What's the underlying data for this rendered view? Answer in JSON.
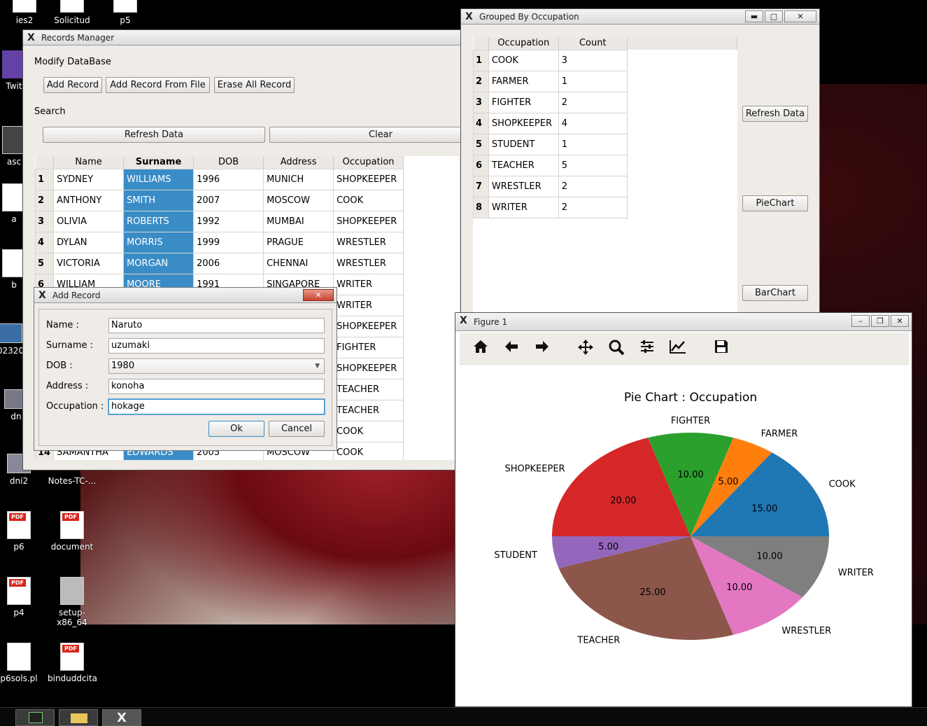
{
  "desktop": {
    "icons": [
      {
        "label": "ies2"
      },
      {
        "label": "Solicitud"
      },
      {
        "label": "p5"
      },
      {
        "label": "Twit"
      },
      {
        "label": "asc"
      },
      {
        "label": "a"
      },
      {
        "label": "b"
      },
      {
        "label": "02320"
      },
      {
        "label": "dn"
      },
      {
        "label": "dni2"
      },
      {
        "label": "Notes-TC-..."
      },
      {
        "label": "p6"
      },
      {
        "label": "document"
      },
      {
        "label": "p4"
      },
      {
        "label": "setup-x86_64"
      },
      {
        "label": "p6sols.pl"
      },
      {
        "label": "binduddcita"
      }
    ]
  },
  "records": {
    "title": "Records Manager",
    "modify_label": "Modify DataBase",
    "add_record": "Add Record",
    "add_from_file": "Add Record From File",
    "erase_all": "Erase All Record",
    "search_label": "Search",
    "refresh": "Refresh Data",
    "clear": "Clear",
    "headers": [
      "Name",
      "Surname",
      "DOB",
      "Address",
      "Occupation"
    ],
    "rows": [
      {
        "n": "1",
        "name": "SYDNEY",
        "surname": "WILLIAMS",
        "dob": "1996",
        "address": "MUNICH",
        "occupation": "SHOPKEEPER"
      },
      {
        "n": "2",
        "name": "ANTHONY",
        "surname": "SMITH",
        "dob": "2007",
        "address": "MOSCOW",
        "occupation": "COOK"
      },
      {
        "n": "3",
        "name": "OLIVIA",
        "surname": "ROBERTS",
        "dob": "1992",
        "address": "MUMBAI",
        "occupation": "SHOPKEEPER"
      },
      {
        "n": "4",
        "name": "DYLAN",
        "surname": "MORRIS",
        "dob": "1999",
        "address": "PRAGUE",
        "occupation": "WRESTLER"
      },
      {
        "n": "5",
        "name": "VICTORIA",
        "surname": "MORGAN",
        "dob": "2006",
        "address": "CHENNAI",
        "occupation": "WRESTLER"
      },
      {
        "n": "6",
        "name": "WILLIAM",
        "surname": "MOORE",
        "dob": "1991",
        "address": "SINGAPORE",
        "occupation": "WRITER"
      }
    ],
    "hidden_occupations": [
      "WRITER",
      "SHOPKEEPER",
      "FIGHTER",
      "SHOPKEEPER",
      "TEACHER",
      "TEACHER",
      "COOK"
    ],
    "last_row": {
      "n": "14",
      "name": "SAMANTHA",
      "surname": "EDWARDS",
      "dob": "2005",
      "address": "MOSCOW",
      "occupation": "COOK"
    }
  },
  "grouped": {
    "title": "Grouped By Occupation",
    "headers": [
      "Occupation",
      "Count"
    ],
    "rows": [
      {
        "n": "1",
        "occ": "COOK",
        "count": "3"
      },
      {
        "n": "2",
        "occ": "FARMER",
        "count": "1"
      },
      {
        "n": "3",
        "occ": "FIGHTER",
        "count": "2"
      },
      {
        "n": "4",
        "occ": "SHOPKEEPER",
        "count": "4"
      },
      {
        "n": "5",
        "occ": "STUDENT",
        "count": "1"
      },
      {
        "n": "6",
        "occ": "TEACHER",
        "count": "5"
      },
      {
        "n": "7",
        "occ": "WRESTLER",
        "count": "2"
      },
      {
        "n": "8",
        "occ": "WRITER",
        "count": "2"
      }
    ],
    "refresh": "Refresh Data",
    "piechart": "PieChart",
    "barchart": "BarChart"
  },
  "dialog": {
    "title": "Add Record",
    "name_label": "Name :",
    "name_value": "Naruto",
    "surname_label": "Surname :",
    "surname_value": "uzumaki",
    "dob_label": "DOB :",
    "dob_value": "1980",
    "address_label": "Address :",
    "address_value": "konoha",
    "occupation_label": "Occupation :",
    "occupation_value": "hokage",
    "ok": "Ok",
    "cancel": "Cancel"
  },
  "figure": {
    "title": "Figure 1",
    "toolbar": [
      "home-icon",
      "back-icon",
      "forward-icon",
      "pan-icon",
      "zoom-icon",
      "configure-icon",
      "edit-axis-icon",
      "save-icon"
    ]
  },
  "chart_data": {
    "type": "pie",
    "title": "Pie Chart : Occupation",
    "categories": [
      "COOK",
      "FARMER",
      "FIGHTER",
      "SHOPKEEPER",
      "STUDENT",
      "TEACHER",
      "WRESTLER",
      "WRITER"
    ],
    "values": [
      15.0,
      5.0,
      10.0,
      20.0,
      5.0,
      25.0,
      10.0,
      10.0
    ],
    "value_labels": [
      "15.00",
      "5.00",
      "10.00",
      "20.00",
      "5.00",
      "25.00",
      "10.00",
      "10.00"
    ],
    "colors": [
      "#1f77b4",
      "#ff7f0e",
      "#2ca02c",
      "#d62728",
      "#9467bd",
      "#8c564b",
      "#e377c2",
      "#7f7f7f"
    ],
    "start_angle_deg": 0,
    "direction": "counterclockwise"
  }
}
